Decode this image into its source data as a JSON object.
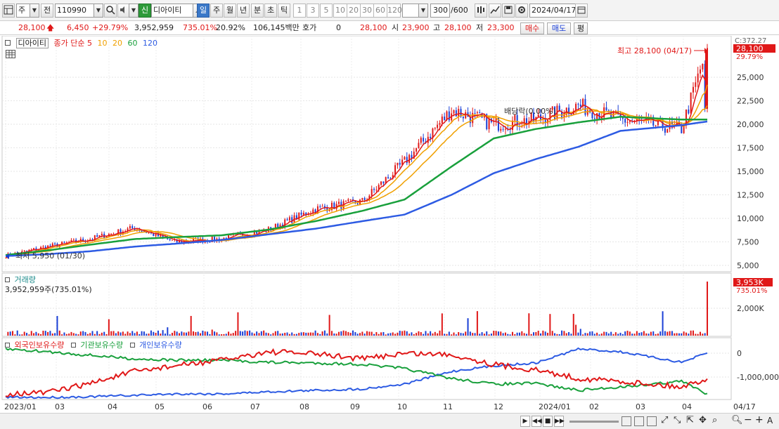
{
  "toolbar": {
    "period": "주",
    "prev": "전",
    "code": "110990",
    "badge": "신",
    "stock_name": "디아이티",
    "intervals": [
      "일",
      "주",
      "월",
      "년",
      "분",
      "초",
      "틱"
    ],
    "active_interval": "일",
    "nums": [
      "1",
      "3",
      "5",
      "10",
      "20",
      "30",
      "60",
      "120"
    ],
    "count": "300",
    "count_max": "/600",
    "date": "2024/04/17"
  },
  "quote": {
    "price": "28,100",
    "change": "6,450",
    "change_pct": "+29.79%",
    "volume": "3,952,959",
    "volume_pct": "735.01%",
    "turnover": "20.92%",
    "amount": "106,145백만",
    "hoga_label": "호가",
    "hoga_value": "0",
    "hoga_price": "28,100",
    "open_label": "시",
    "open": "23,900",
    "high_label": "고",
    "high": "28,100",
    "low_label": "저",
    "low": "23,300",
    "buy": "매수",
    "sell": "매도",
    "eval": "평"
  },
  "price_legend": {
    "stock": "디아이티",
    "ma_title": "종가 단순 5",
    "ma10": "10",
    "ma20": "20",
    "ma60": "60",
    "ma120": "120"
  },
  "colors": {
    "ma5": "#e01818",
    "ma10": "#f0a000",
    "ma20": "#f0a000",
    "ma60": "#19a03c",
    "ma120": "#2d5be3",
    "up": "#e01818",
    "down": "#1a3fd6",
    "foreign": "#e01818",
    "inst": "#19a03c",
    "personal": "#2d5be3"
  },
  "annotations": {
    "high_text": "최고 28,100 (04/17)",
    "low_text": "최저 5,950 (01/30)",
    "dividend": "배당락(0.00%)",
    "current_tag": "28,100",
    "current_pct": "29.79%",
    "top_tag": "C:372.27"
  },
  "volume_legend": {
    "title": "거래량",
    "value": "3,952,959주(735.01%)",
    "tag": "3,953K",
    "tag_pct": "735.01%"
  },
  "flow_legend": {
    "foreign": "외국인보유수량",
    "inst": "기관보유수량",
    "personal": "개인보유수량"
  },
  "chart_data": {
    "type": "line",
    "title": "",
    "price_axis": [
      "25,000",
      "22,500",
      "20,000",
      "17,500",
      "15,000",
      "12,500",
      "10,000",
      "7,500",
      "5,000"
    ],
    "volume_axis": [
      "2,000K"
    ],
    "flow_axis": [
      "0",
      "-1,000,000"
    ],
    "x_ticks": [
      "2023/01",
      "03",
      "04",
      "05",
      "06",
      "07",
      "08",
      "09",
      "10",
      "11",
      "12",
      "2024/01",
      "02",
      "03",
      "04",
      "04/17"
    ],
    "series": [
      {
        "x": [
          "2023/01",
          "2023/02",
          "2023/03",
          "2023/04",
          "2023/05",
          "2023/06",
          "2023/07",
          "2023/08",
          "2023/09",
          "2023/10",
          "2023/11",
          "2023/12",
          "2024/01",
          "2024/02",
          "2024/03",
          "2024/04",
          "2024/04/17"
        ],
        "values": [
          6000,
          7000,
          7800,
          9000,
          7500,
          7800,
          8800,
          11000,
          11800,
          16000,
          21500,
          20000,
          20500,
          22000,
          20500,
          19500,
          28100
        ]
      },
      {
        "name": "60",
        "values": [
          6100,
          6600,
          7200,
          7800,
          8000,
          8200,
          8800,
          9700,
          10800,
          12000,
          15500,
          18500,
          19500,
          20200,
          20800,
          20500,
          20500
        ]
      },
      {
        "name": "120",
        "values": [
          6000,
          6200,
          6500,
          7000,
          7300,
          7700,
          8300,
          8900,
          9700,
          10400,
          12500,
          14800,
          16300,
          17600,
          19300,
          19900,
          20300
        ]
      }
    ],
    "high": 28100,
    "low": 5950,
    "volume_last": 3952959
  },
  "status": {
    "bottom_label": "A"
  }
}
